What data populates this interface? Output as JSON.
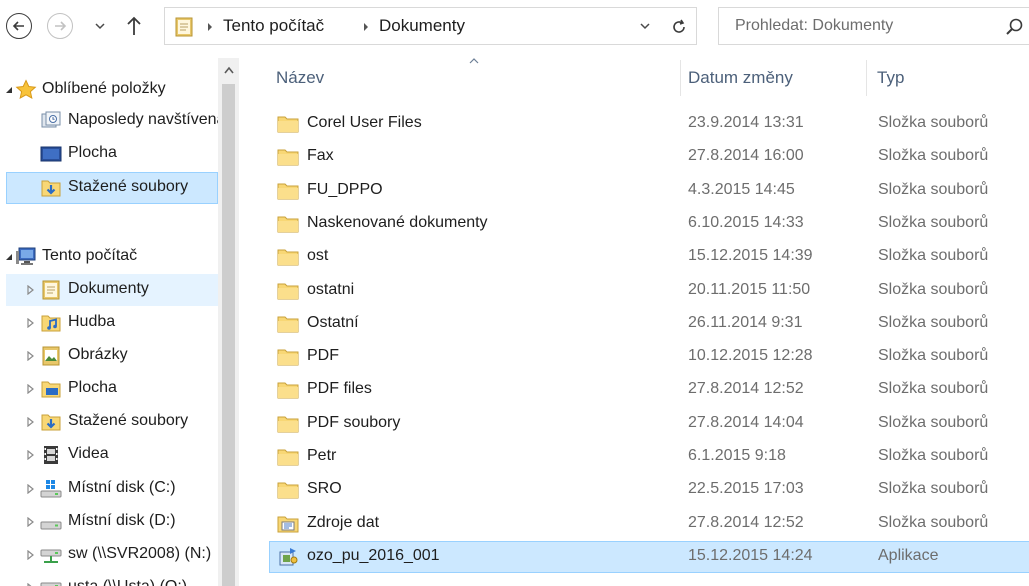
{
  "address_bar": {
    "breadcrumbs": [
      "Tento počítač",
      "Dokumenty"
    ],
    "search_placeholder": "Prohledat: Dokumenty"
  },
  "navigation": {
    "favorites": {
      "label": "Oblíbené položky",
      "items": [
        {
          "label": "Naposledy navštívená místa",
          "icon": "recent-places-icon"
        },
        {
          "label": "Plocha",
          "icon": "desktop-icon"
        },
        {
          "label": "Stažené soubory",
          "icon": "downloads-icon",
          "selected": true
        }
      ]
    },
    "computer": {
      "label": "Tento počítač",
      "items": [
        {
          "label": "Dokumenty",
          "icon": "documents-icon",
          "hover": true
        },
        {
          "label": "Hudba",
          "icon": "music-icon"
        },
        {
          "label": "Obrázky",
          "icon": "pictures-icon"
        },
        {
          "label": "Plocha",
          "icon": "desktop-icon"
        },
        {
          "label": "Stažené soubory",
          "icon": "downloads-icon"
        },
        {
          "label": "Videa",
          "icon": "videos-icon"
        },
        {
          "label": "Místní disk (C:)",
          "icon": "windows-drive-icon"
        },
        {
          "label": "Místní disk (D:)",
          "icon": "drive-icon"
        },
        {
          "label": "sw (\\\\SVR2008) (N:)",
          "icon": "network-drive-icon"
        },
        {
          "label": "usta (\\\\Usta) (O:)",
          "icon": "network-drive-icon"
        }
      ]
    }
  },
  "columns": {
    "name": "Název",
    "date": "Datum změny",
    "type": "Typ"
  },
  "files": [
    {
      "name": "Corel User Files",
      "date": "23.9.2014 13:31",
      "type": "Složka souborů",
      "icon": "folder-icon"
    },
    {
      "name": "Fax",
      "date": "27.8.2014 16:00",
      "type": "Složka souborů",
      "icon": "folder-icon"
    },
    {
      "name": "FU_DPPO",
      "date": "4.3.2015 14:45",
      "type": "Složka souborů",
      "icon": "folder-icon"
    },
    {
      "name": "Naskenované dokumenty",
      "date": "6.10.2015 14:33",
      "type": "Složka souborů",
      "icon": "folder-icon"
    },
    {
      "name": "ost",
      "date": "15.12.2015 14:39",
      "type": "Složka souborů",
      "icon": "folder-icon"
    },
    {
      "name": "ostatni",
      "date": "20.11.2015 11:50",
      "type": "Složka souborů",
      "icon": "folder-icon"
    },
    {
      "name": "Ostatní",
      "date": "26.11.2014 9:31",
      "type": "Složka souborů",
      "icon": "folder-icon"
    },
    {
      "name": "PDF",
      "date": "10.12.2015 12:28",
      "type": "Složka souborů",
      "icon": "folder-icon"
    },
    {
      "name": "PDF files",
      "date": "27.8.2014 12:52",
      "type": "Složka souborů",
      "icon": "folder-icon"
    },
    {
      "name": "PDF soubory",
      "date": "27.8.2014 14:04",
      "type": "Složka souborů",
      "icon": "folder-icon"
    },
    {
      "name": "Petr",
      "date": "6.1.2015 9:18",
      "type": "Složka souborů",
      "icon": "folder-icon"
    },
    {
      "name": "SRO",
      "date": "22.5.2015 17:03",
      "type": "Složka souborů",
      "icon": "folder-icon"
    },
    {
      "name": "Zdroje dat",
      "date": "27.8.2014 12:52",
      "type": "Složka souborů",
      "icon": "data-sources-icon"
    },
    {
      "name": "ozo_pu_2016_001",
      "date": "15.12.2015 14:24",
      "type": "Aplikace",
      "icon": "installer-icon",
      "selected": true
    }
  ],
  "colors": {
    "selection_bg": "#cce8ff",
    "selection_border": "#99d1ff",
    "hover_bg": "#e5f3ff",
    "folder_yellow": "#f8d775",
    "header_text": "#4c607a"
  }
}
